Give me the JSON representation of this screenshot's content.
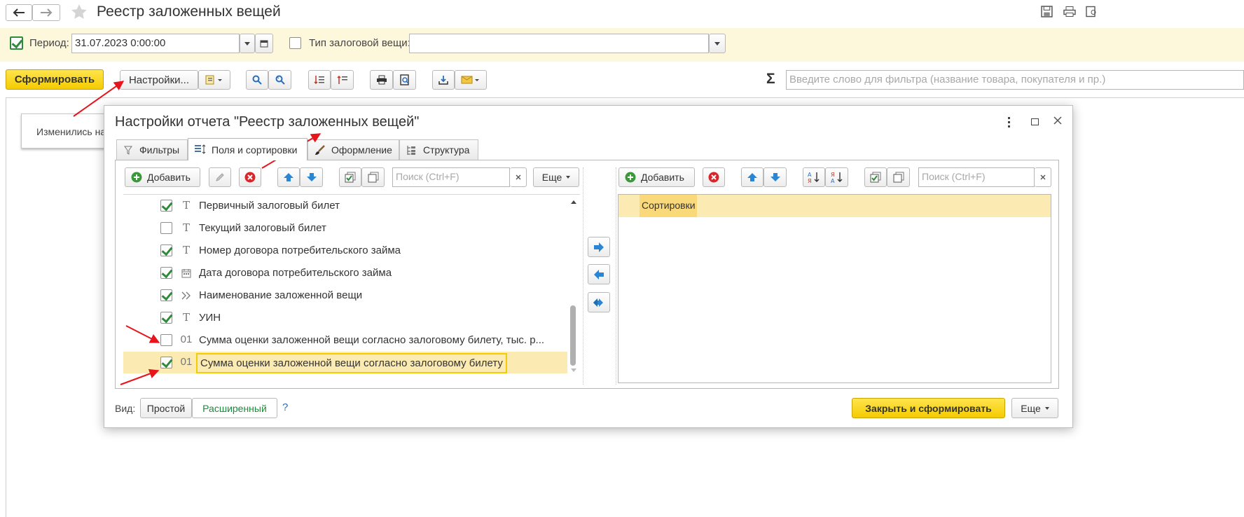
{
  "window": {
    "title": "Реестр заложенных вещей"
  },
  "filters": {
    "period_label": "Период:",
    "period_value": "31.07.2023  0:00:00",
    "period_checked": true,
    "type_label": "Тип залоговой вещи:",
    "type_checked": false,
    "type_value": ""
  },
  "toolbar": {
    "generate": "Сформировать",
    "settings": "Настройки...",
    "sum_symbol": "Σ",
    "filter_placeholder": "Введите слово для фильтра (название товара, покупателя и пр.)"
  },
  "background": {
    "notice": "Изменились на"
  },
  "dialog": {
    "title": "Настройки отчета \"Реестр заложенных вещей\"",
    "tabs": [
      {
        "label": "Фильтры",
        "active": false
      },
      {
        "label": "Поля и сортировки",
        "active": true
      },
      {
        "label": "Оформление",
        "active": false
      },
      {
        "label": "Структура",
        "active": false
      }
    ],
    "left": {
      "add": "Добавить",
      "search_placeholder": "Поиск (Ctrl+F)",
      "more": "Еще",
      "fields": [
        {
          "checked": true,
          "type": "T",
          "label": "Первичный залоговый билет"
        },
        {
          "checked": false,
          "type": "T",
          "label": "Текущий залоговый билет"
        },
        {
          "checked": true,
          "type": "T",
          "label": "Номер договора потребительского займа"
        },
        {
          "checked": true,
          "type": "date",
          "label": "Дата договора потребительского займа"
        },
        {
          "checked": true,
          "type": ">>",
          "label": "Наименование заложенной вещи"
        },
        {
          "checked": true,
          "type": "T",
          "label": "УИН"
        },
        {
          "checked": false,
          "type": "01",
          "label": "Сумма оценки заложенной вещи согласно залоговому билету, тыс. р..."
        },
        {
          "checked": true,
          "type": "01",
          "label": "Сумма оценки заложенной вещи согласно залоговому билету",
          "selected": true
        }
      ]
    },
    "right": {
      "add": "Добавить",
      "search_placeholder": "Поиск (Ctrl+F)",
      "root_item": "Сортировки"
    },
    "footer": {
      "view_label": "Вид:",
      "view_simple": "Простой",
      "view_extended": "Расширенный",
      "help": "?",
      "close_generate": "Закрыть и сформировать",
      "more": "Еще"
    }
  },
  "colors": {
    "accent_yellow": "#f5cc00",
    "filter_bar_bg": "#fdf8dc",
    "selection_bg": "#fbeab1",
    "checkbox_green": "#2e8b3a",
    "annotation_red": "#e8141c",
    "link_green": "#1a8a3a"
  }
}
